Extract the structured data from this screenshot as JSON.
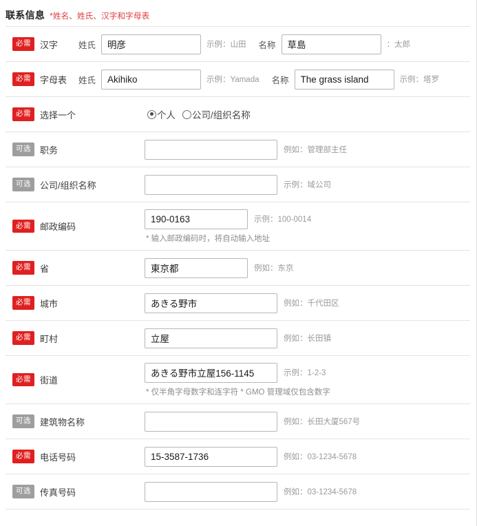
{
  "header": {
    "title": "联系信息",
    "note": "*姓名、姓氏、汉字和字母表"
  },
  "labels": {
    "surname": "姓氏",
    "givenname": "名称"
  },
  "colors": {
    "required_badge": "#e02020",
    "optional_badge": "#9e9e9e",
    "note_red": "#e03a3a"
  },
  "badges": {
    "required": "必需",
    "optional": "可选"
  },
  "rows": {
    "kanji": {
      "badge": "必需",
      "label": "汉字",
      "surname_label": "姓氏",
      "surname_value": "明彦",
      "surname_hint": "示例：山田",
      "given_label": "名称",
      "given_value": "草島",
      "given_hint": "：太郎"
    },
    "kana": {
      "badge": "必需",
      "label": "字母表",
      "surname_label": "姓氏",
      "surname_value": "Akihiko",
      "surname_hint": "示例：Yamada",
      "given_label": "名称",
      "given_value": "The grass island",
      "given_hint": "示例：塔罗"
    },
    "choose": {
      "badge": "必需",
      "label": "选择一个",
      "option_individual": "个人",
      "option_company": "公司/组织名称",
      "selected": "个人"
    },
    "position": {
      "badge": "可选",
      "label": "职务",
      "value": "",
      "hint": "例如：管理部主任"
    },
    "company": {
      "badge": "可选",
      "label": "公司/组织名称",
      "value": "",
      "hint": "示例：域公司"
    },
    "postal": {
      "badge": "必需",
      "label": "邮政编码",
      "value": "190-0163",
      "hint": "示例：100-0014",
      "note": "* 输入邮政编码时，将自动输入地址"
    },
    "province": {
      "badge": "必需",
      "label": "省",
      "value": "東京都",
      "hint": "例如：东京"
    },
    "city": {
      "badge": "必需",
      "label": "城市",
      "value": "あきる野市",
      "hint": "例如：千代田区"
    },
    "town": {
      "badge": "必需",
      "label": "町村",
      "value": "立屋",
      "hint": "例如：长田镇"
    },
    "street": {
      "badge": "必需",
      "label": "街道",
      "value": "あきる野市立屋156-1145",
      "hint": "示例：1-2-3",
      "note": "* 仅半角字母数字和连字符 * GMO 管理域仅包含数字"
    },
    "building": {
      "badge": "可选",
      "label": "建筑物名称",
      "value": "",
      "hint": "例如：长田大厦567号"
    },
    "phone": {
      "badge": "必需",
      "label": "电话号码",
      "value": "15-3587-1736",
      "hint": "例如：03-1234-5678"
    },
    "fax": {
      "badge": "可选",
      "label": "传真号码",
      "value": "",
      "hint": "例如：03-1234-5678"
    }
  }
}
